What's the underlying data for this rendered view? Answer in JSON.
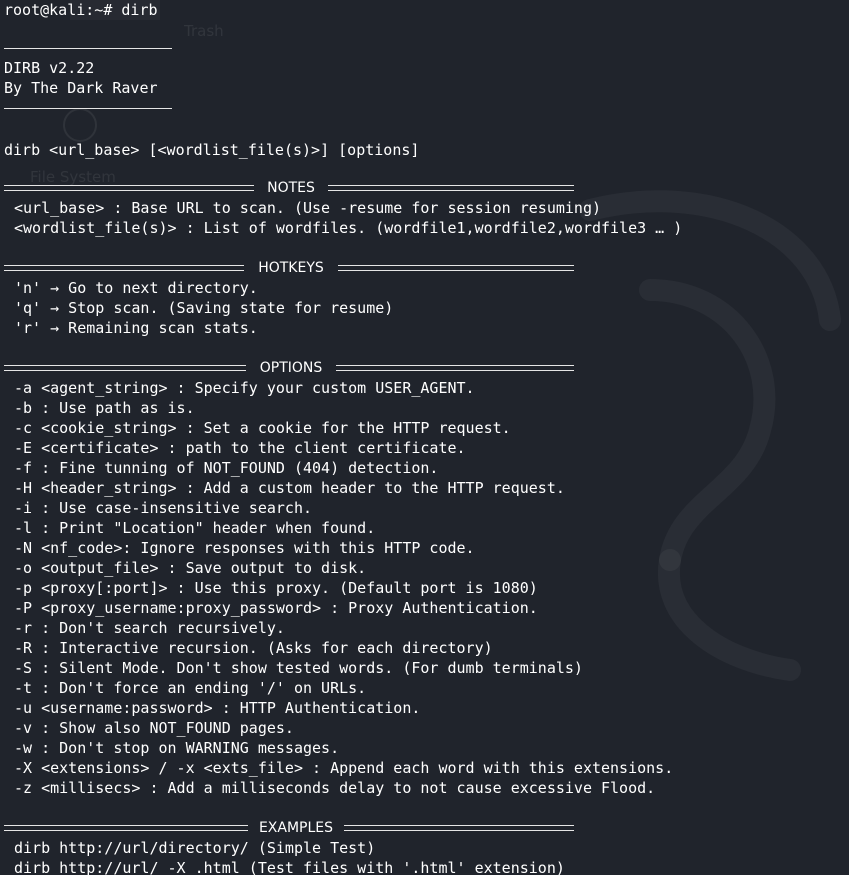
{
  "desktop": {
    "trash_label": "Trash",
    "filesystem_label": "File System"
  },
  "terminal": {
    "prompt": "root@kali:~# dirb",
    "banner": {
      "version": "DIRB v2.22",
      "author": "By The Dark Raver"
    },
    "usage": "dirb <url_base> [<wordlist_file(s)>] [options]",
    "sections": {
      "notes": {
        "title": "NOTES",
        "lines": [
          "<url_base> : Base URL to scan. (Use -resume for session resuming)",
          "<wordlist_file(s)> : List of wordfiles. (wordfile1,wordfile2,wordfile3 … )"
        ]
      },
      "hotkeys": {
        "title": "HOTKEYS",
        "lines": [
          "'n' → Go to next directory.",
          "'q' → Stop scan. (Saving state for resume)",
          "'r' → Remaining scan stats."
        ]
      },
      "options": {
        "title": "OPTIONS",
        "lines": [
          "-a <agent_string> : Specify your custom USER_AGENT.",
          "-b : Use path as is.",
          "-c <cookie_string> : Set a cookie for the HTTP request.",
          "-E <certificate> : path to the client certificate.",
          "-f : Fine tunning of NOT_FOUND (404) detection.",
          "-H <header_string> : Add a custom header to the HTTP request.",
          "-i : Use case-insensitive search.",
          "-l : Print \"Location\" header when found.",
          "-N <nf_code>: Ignore responses with this HTTP code.",
          "-o <output_file> : Save output to disk.",
          "-p <proxy[:port]> : Use this proxy. (Default port is 1080)",
          "-P <proxy_username:proxy_password> : Proxy Authentication.",
          "-r : Don't search recursively.",
          "-R : Interactive recursion. (Asks for each directory)",
          "-S : Silent Mode. Don't show tested words. (For dumb terminals)",
          "-t : Don't force an ending '/' on URLs.",
          "-u <username:password> : HTTP Authentication.",
          "-v : Show also NOT_FOUND pages.",
          "-w : Don't stop on WARNING messages.",
          "-X <extensions> / -x <exts_file> : Append each word with this extensions.",
          "-z <millisecs> : Add a milliseconds delay to not cause excessive Flood."
        ]
      },
      "examples": {
        "title": "EXAMPLES",
        "lines": [
          "dirb http://url/directory/ (Simple Test)",
          "dirb http://url/ -X .html (Test files with '.html' extension)"
        ]
      }
    }
  }
}
